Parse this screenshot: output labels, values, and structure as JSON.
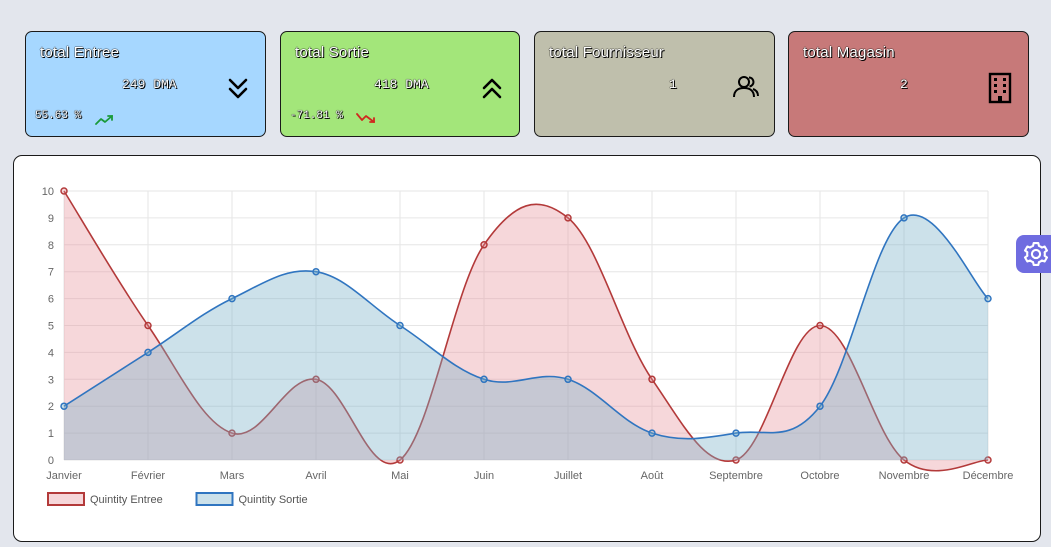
{
  "cards": {
    "entree": {
      "title": "total Entree",
      "value": "249 DMA",
      "percent": "55.63 %",
      "trend": "up",
      "color": "#a6d7ff"
    },
    "sortie": {
      "title": "total Sortie",
      "value": "418 DMA",
      "percent": "-71.81 %",
      "trend": "down",
      "color": "#a3e67a"
    },
    "fournisseur": {
      "title": "total Fournisseur",
      "value": "1",
      "color": "#bfbfac"
    },
    "magasin": {
      "title": "total Magasin",
      "value": "2",
      "color": "#c77979"
    }
  },
  "icons": {
    "entree": "double-chevron-down-icon",
    "sortie": "double-chevron-up-icon",
    "fournisseur": "users-icon",
    "magasin": "building-icon",
    "settings": "gear-icon"
  },
  "chart_data": {
    "type": "area",
    "categories": [
      "Janvier",
      "Février",
      "Mars",
      "Avril",
      "Mai",
      "Juin",
      "Juillet",
      "Août",
      "Septembre",
      "Octobre",
      "Novembre",
      "Décembre"
    ],
    "series": [
      {
        "name": "Quintity Entree",
        "values": [
          10,
          5,
          1,
          3,
          0,
          8,
          9,
          3,
          0,
          5,
          0,
          0
        ],
        "color": "#b33a3a",
        "fill": "rgba(230,140,150,0.35)"
      },
      {
        "name": "Quintity Sortie",
        "values": [
          2,
          4,
          6,
          7,
          5,
          3,
          3,
          1,
          1,
          2,
          9,
          6
        ],
        "color": "#3075c0",
        "fill": "rgba(120,175,200,0.38)"
      }
    ],
    "ylim": [
      0,
      10
    ],
    "yticks": [
      "0",
      "1",
      "2",
      "3",
      "4",
      "5",
      "6",
      "7",
      "8",
      "9",
      "10"
    ],
    "grid": true,
    "legend": "bottom-left"
  }
}
